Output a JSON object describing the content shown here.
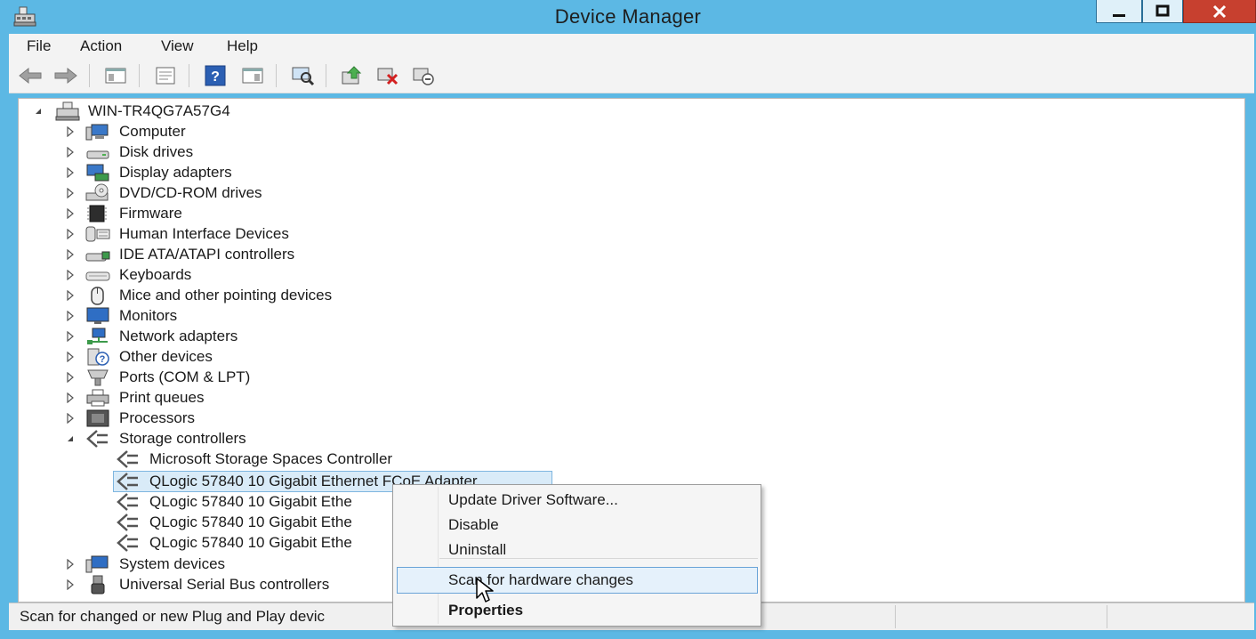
{
  "window": {
    "title": "Device Manager"
  },
  "menu": [
    "File",
    "Action",
    "View",
    "Help"
  ],
  "tree": {
    "root": "WIN-TR4QG7A57G4",
    "categories": [
      "Computer",
      "Disk drives",
      "Display adapters",
      "DVD/CD-ROM drives",
      "Firmware",
      "Human Interface Devices",
      "IDE ATA/ATAPI controllers",
      "Keyboards",
      "Mice and other pointing devices",
      "Monitors",
      "Network adapters",
      "Other devices",
      "Ports (COM & LPT)",
      "Print queues",
      "Processors",
      "Storage controllers"
    ],
    "storage_children": [
      "Microsoft Storage Spaces Controller",
      "QLogic 57840 10 Gigabit Ethernet FCoE Adapter",
      "QLogic 57840 10 Gigabit Ethe",
      "QLogic 57840 10 Gigabit Ethe",
      "QLogic 57840 10 Gigabit Ethe"
    ],
    "after_categories": [
      "System devices",
      "Universal Serial Bus controllers"
    ]
  },
  "context_menu": {
    "items": [
      "Update Driver Software...",
      "Disable",
      "Uninstall",
      "Scan for hardware changes",
      "Properties"
    ]
  },
  "statusbar": {
    "text": "Scan for changed or new Plug and Play devic"
  },
  "colors": {
    "titlebar": "#5cb8e4",
    "close_button": "#c7402f",
    "selection": "#d9ebf8",
    "highlight_border": "#6aa4d8"
  }
}
